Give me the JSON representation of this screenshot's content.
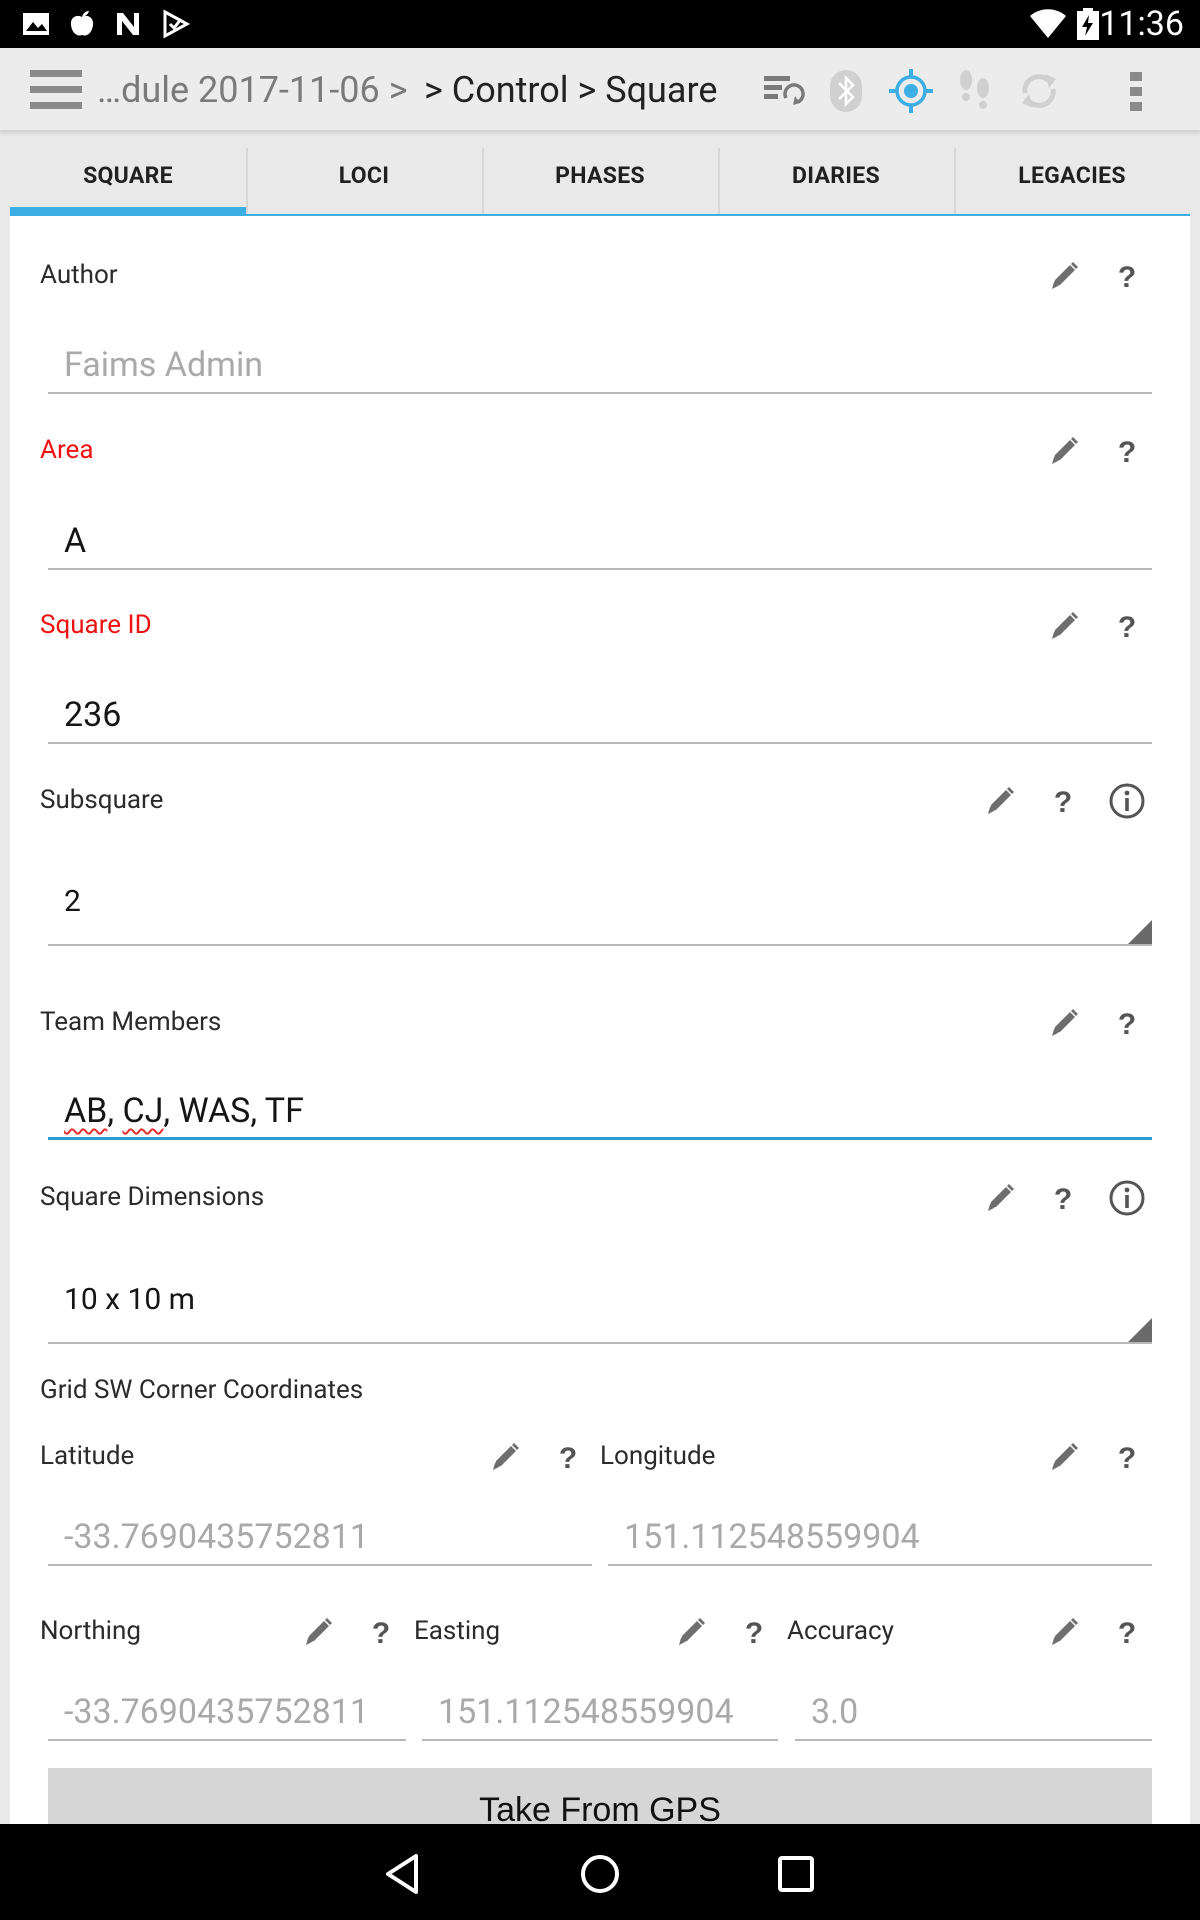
{
  "status_bar": {
    "time": "11:36"
  },
  "action_bar": {
    "breadcrumb_faded": "…dule 2017-11-06 >",
    "breadcrumb_main": "> Control > Square",
    "colors": {
      "gps_active": "#3daee4",
      "inactive": "#d0d0d0"
    }
  },
  "tabs": [
    {
      "label": "SQUARE",
      "active": true
    },
    {
      "label": "LOCI"
    },
    {
      "label": "PHASES"
    },
    {
      "label": "DIARIES"
    },
    {
      "label": "LEGACIES"
    }
  ],
  "form": {
    "author": {
      "label": "Author",
      "placeholder": "Faims Admin"
    },
    "area": {
      "label": "Area",
      "value": "A"
    },
    "square_id": {
      "label": "Square ID",
      "value": "236"
    },
    "subsquare": {
      "label": "Subsquare",
      "value": "2"
    },
    "team_members": {
      "label": "Team Members",
      "value_parts": [
        "AB",
        "CJ",
        "WAS, TF"
      ]
    },
    "square_dimensions": {
      "label": "Square Dimensions",
      "value": "10 x 10 m"
    },
    "grid_heading": "Grid SW Corner Coordinates",
    "latitude": {
      "label": "Latitude",
      "placeholder": "-33.7690435752811"
    },
    "longitude": {
      "label": "Longitude",
      "placeholder": "151.112548559904"
    },
    "northing": {
      "label": "Northing",
      "placeholder": "-33.7690435752811"
    },
    "easting": {
      "label": "Easting",
      "placeholder": "151.112548559904"
    },
    "accuracy": {
      "label": "Accuracy",
      "placeholder": "3.0"
    },
    "gps_button_label": "Take From GPS",
    "colors": {
      "required_label": "#ee1111",
      "focus_underline": "#2a9bd4",
      "tab_accent": "#3daee4"
    }
  }
}
